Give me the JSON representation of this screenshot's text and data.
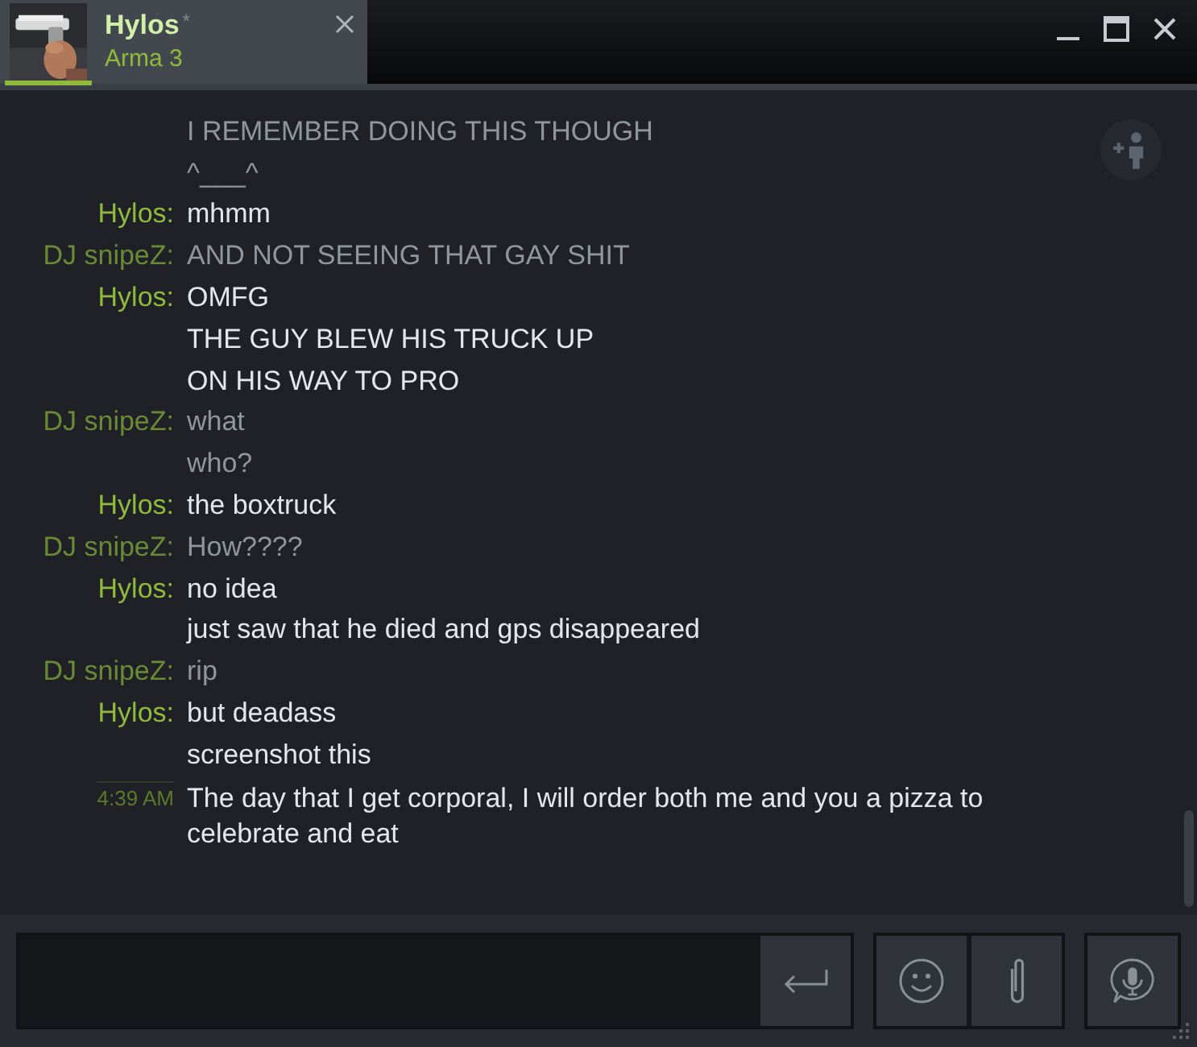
{
  "tab": {
    "name": "Hylos",
    "status_mark": "*",
    "game": "Arma 3",
    "selected": true
  },
  "messages": [
    {
      "kind": "friend",
      "lines": [
        "I REMEMBER DOING THIS THOUGH",
        "^___^"
      ]
    },
    {
      "kind": "self",
      "sender": "Hylos:",
      "lines": [
        "mhmm"
      ]
    },
    {
      "kind": "friend",
      "sender": "DJ snipeZ:",
      "lines": [
        "AND NOT SEEING THAT GAY SHIT"
      ]
    },
    {
      "kind": "self",
      "sender": "Hylos:",
      "lines": [
        "OMFG",
        "THE GUY BLEW HIS TRUCK UP",
        "ON HIS WAY TO PRO"
      ]
    },
    {
      "kind": "friend",
      "sender": "DJ snipeZ:",
      "lines": [
        "what",
        "who?"
      ]
    },
    {
      "kind": "self",
      "sender": "Hylos:",
      "lines": [
        "the boxtruck"
      ]
    },
    {
      "kind": "friend",
      "sender": "DJ snipeZ:",
      "lines": [
        "How????"
      ]
    },
    {
      "kind": "self",
      "sender": "Hylos:",
      "lines": [
        "no idea",
        "just saw that he died and gps disappeared"
      ]
    },
    {
      "kind": "friend",
      "sender": "DJ snipeZ:",
      "lines": [
        "rip"
      ]
    },
    {
      "kind": "self",
      "sender": "Hylos:",
      "lines": [
        "but deadass",
        "screenshot this"
      ]
    },
    {
      "kind": "self",
      "time": "4:39 AM",
      "lines": [
        "The day that I get corporal, I will order both me and you a pizza to celebrate and eat"
      ]
    }
  ]
}
